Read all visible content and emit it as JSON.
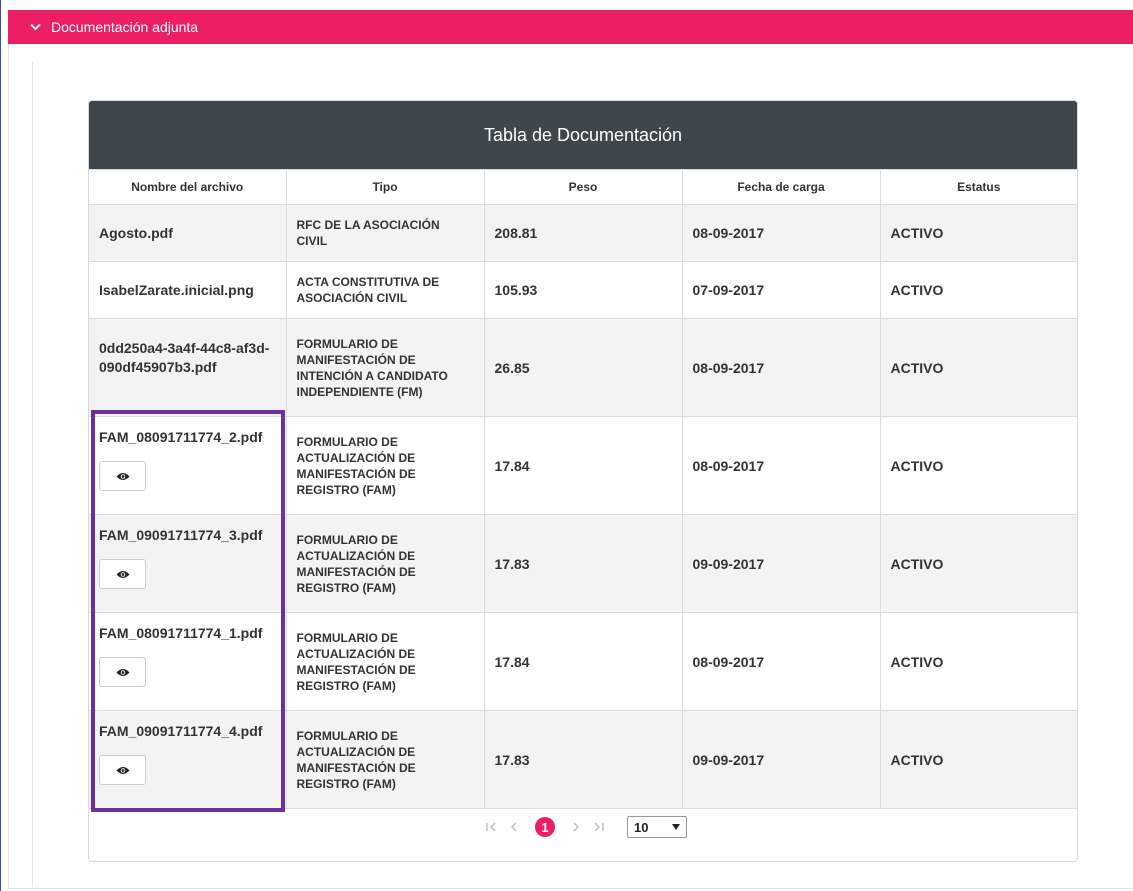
{
  "section": {
    "title": "Documentación adjunta"
  },
  "table": {
    "title": "Tabla de Documentación",
    "headers": [
      "Nombre del archivo",
      "Tipo",
      "Peso",
      "Fecha de carga",
      "Estatus"
    ],
    "rows": [
      {
        "file": "Agosto.pdf",
        "type": "RFC DE LA ASOCIACIÓN CIVIL",
        "size": "208.81",
        "date": "08-09-2017",
        "status": "ACTIVO"
      },
      {
        "file": "IsabelZarate.inicial.png",
        "type": "ACTA CONSTITUTIVA DE ASOCIACIÓN CIVIL",
        "size": "105.93",
        "date": "07-09-2017",
        "status": "ACTIVO"
      },
      {
        "file": "0dd250a4-3a4f-44c8-af3d-090df45907b3.pdf",
        "type": "FORMULARIO DE MANIFESTACIÓN DE INTENCIÓN A CANDIDATO INDEPENDIENTE (FM)",
        "size": "26.85",
        "date": "08-09-2017",
        "status": "ACTIVO"
      },
      {
        "file": "FAM_08091711774_2.pdf",
        "type": "FORMULARIO DE ACTUALIZACIÓN DE MANIFESTACIÓN DE REGISTRO (FAM)",
        "size": "17.84",
        "date": "08-09-2017",
        "status": "ACTIVO"
      },
      {
        "file": "FAM_09091711774_3.pdf",
        "type": "FORMULARIO DE ACTUALIZACIÓN DE MANIFESTACIÓN DE REGISTRO (FAM)",
        "size": "17.83",
        "date": "09-09-2017",
        "status": "ACTIVO"
      },
      {
        "file": "FAM_08091711774_1.pdf",
        "type": "FORMULARIO DE ACTUALIZACIÓN DE MANIFESTACIÓN DE REGISTRO (FAM)",
        "size": "17.84",
        "date": "08-09-2017",
        "status": "ACTIVO"
      },
      {
        "file": "FAM_09091711774_4.pdf",
        "type": "FORMULARIO DE ACTUALIZACIÓN DE MANIFESTACIÓN DE REGISTRO (FAM)",
        "size": "17.83",
        "date": "09-09-2017",
        "status": "ACTIVO"
      }
    ]
  },
  "pagination": {
    "current_page": "1",
    "page_size": "10"
  },
  "icons": {
    "view": "eye-icon",
    "section_toggle": "chevron-down-icon"
  },
  "colors": {
    "accent": "#ec1f64",
    "header_bg": "#3d464d",
    "highlight": "#6b2fa0"
  }
}
